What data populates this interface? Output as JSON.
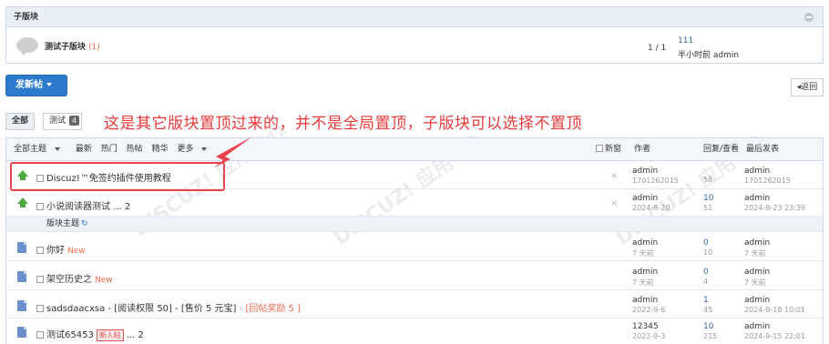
{
  "subforum": {
    "header": "子版块",
    "name": "测试子版块",
    "count": "(1)",
    "pages": "1 / 1",
    "last_post_link": "111",
    "last_post_meta": "半小时前 admin"
  },
  "toolbar": {
    "post_label": "发新帖",
    "back_label": "返回"
  },
  "tabs": {
    "all": "全部",
    "test": "测试",
    "test_count": "4"
  },
  "annotation": "这是其它版块置顶过来的，并不是全局置顶，子版块可以选择不置顶",
  "table_header": {
    "filters": [
      "全部主题",
      "最新",
      "热门",
      "热帖",
      "精华",
      "更多"
    ],
    "new_window": "新窗",
    "author": "作者",
    "replies_views": "回复/查看",
    "last_post": "最后发表"
  },
  "separator_label": "版块主题",
  "threads": [
    {
      "title": "Discuz!™免签约插件使用教程",
      "author": "admin",
      "author_date": "1701262015",
      "replies": "",
      "views": "58",
      "last_author": "admin",
      "last_date": "1701262015",
      "icon": "sticky-up"
    },
    {
      "title": "小说阅读器测试",
      "suffix": "... 2",
      "author": "admin",
      "author_date": "2024-8-20",
      "replies": "10",
      "views": "51",
      "last_author": "admin",
      "last_date": "2024-9-23 23:39",
      "icon": "sticky-up"
    },
    {
      "title": "你好",
      "tag_new": "New",
      "author": "admin",
      "author_date": "7 天前",
      "replies": "0",
      "views": "10",
      "last_author": "admin",
      "last_date": "7 天前",
      "icon": "doc"
    },
    {
      "title": "架空历史之",
      "tag_new": "New",
      "author": "admin",
      "author_date": "7 天前",
      "replies": "0",
      "views": "4",
      "last_author": "admin",
      "last_date": "7 天前",
      "icon": "doc"
    },
    {
      "title": "sadsdaacxsa",
      "extra_1": "- [阅读权限 50]",
      "extra_2": "- [售价 5 元宝]",
      "extra_3": "- [回帖奖励 5 ]",
      "author": "admin",
      "author_date": "2022-9-6",
      "replies": "1",
      "views": "45",
      "last_author": "admin",
      "last_date": "2024-9-18 10:01",
      "icon": "doc"
    },
    {
      "title": "测试65453",
      "label": "新人帖",
      "suffix": "... 2",
      "author": "12345",
      "author_date": "2022-9-3",
      "replies": "10",
      "views": "215",
      "last_author": "admin",
      "last_date": "2024-9-15 22:01",
      "icon": "doc"
    }
  ],
  "colors": {
    "accent": "#2b7acd",
    "annotation": "#e83a3a",
    "sticky_green": "#4aaa3d",
    "header_bg": "#e8eff5"
  }
}
